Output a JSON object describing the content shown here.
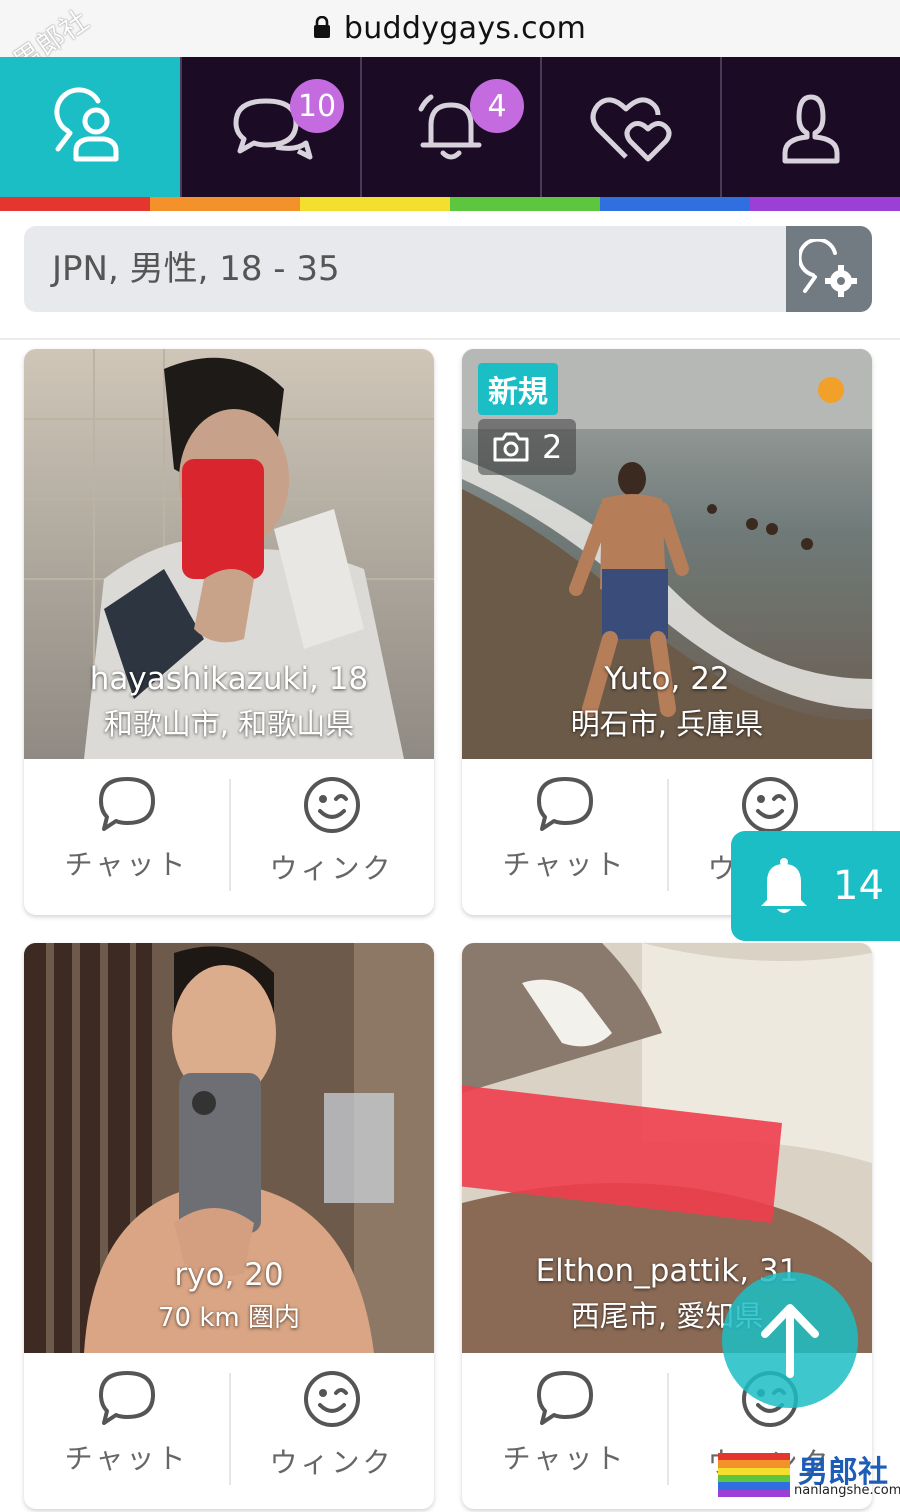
{
  "browser": {
    "domain": "buddygays.com"
  },
  "watermark": "男郎社",
  "nav": {
    "tabs": [
      {
        "name": "search"
      },
      {
        "name": "messages",
        "badge": "10"
      },
      {
        "name": "notifications",
        "badge": "4"
      },
      {
        "name": "favorites"
      },
      {
        "name": "profile"
      }
    ]
  },
  "colors": {
    "accent": "#1cbec6",
    "nav_bg": "#1b0b25",
    "badge": "#c46be0",
    "rainbow": [
      "#e4352f",
      "#f3922a",
      "#f5df2e",
      "#5bc63e",
      "#2f6fe0",
      "#9b3fd6"
    ]
  },
  "search": {
    "query": "JPN, 男性, 18 - 35"
  },
  "cards": [
    {
      "name": "hayashikazuki, 18",
      "location": "和歌山市, 和歌山県",
      "chat": "チャット",
      "wink": "ウィンク"
    },
    {
      "name": "Yuto, 22",
      "location": "明石市, 兵庫県",
      "new_tag": "新規",
      "photo_count": "2",
      "chat": "チャット",
      "wink": "ウィンク"
    },
    {
      "name": "ryo, 20",
      "location": "70 km 圏内",
      "chat": "チャット",
      "wink": "ウィンク"
    },
    {
      "name": "Elthon_pattik, 31",
      "location": "西尾市, 愛知県",
      "chat": "チャット",
      "wink": "ウィンク"
    }
  ],
  "floating_notification": {
    "count": "14"
  },
  "site_logo": {
    "cn": "男郎社",
    "en": "nanlangshe.com"
  }
}
